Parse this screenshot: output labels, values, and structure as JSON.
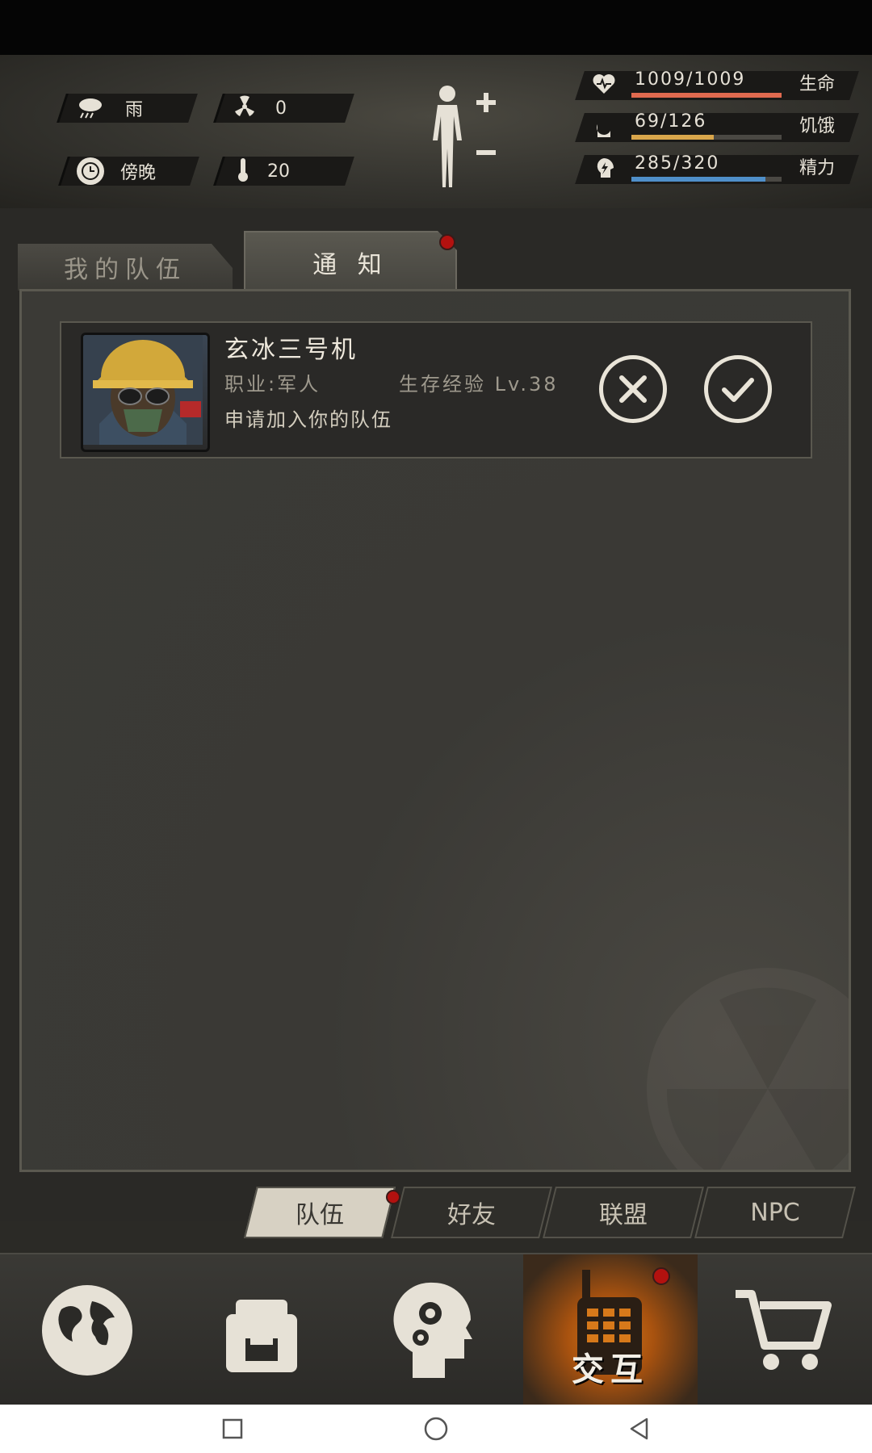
{
  "hud": {
    "weather": "雨",
    "radiation": "0",
    "time_of_day": "傍晚",
    "temperature": "20",
    "stats": [
      {
        "icon": "heart-icon",
        "value": "1009/1009",
        "label": "生命",
        "fraction": 1.0,
        "color": "#e06a4f"
      },
      {
        "icon": "stomach-icon",
        "value": "69/126",
        "label": "饥饿",
        "fraction": 0.55,
        "color": "#d9a64b"
      },
      {
        "icon": "brain-energy-icon",
        "value": "285/320",
        "label": "精力",
        "fraction": 0.89,
        "color": "#4f8fc9"
      }
    ]
  },
  "tabs": {
    "team": "我的队伍",
    "notice": "通 知"
  },
  "notification": {
    "name": "玄冰三号机",
    "job": "职业:军人",
    "exp": "生存经验 Lv.38",
    "message": "申请加入你的队伍"
  },
  "subtabs": {
    "team": "队伍",
    "friends": "好友",
    "alliance": "联盟",
    "npc": "NPC"
  },
  "nav": {
    "interact": "交互"
  },
  "colors": {
    "accent_orange": "#d7791a",
    "alert_red": "#b3110f"
  }
}
